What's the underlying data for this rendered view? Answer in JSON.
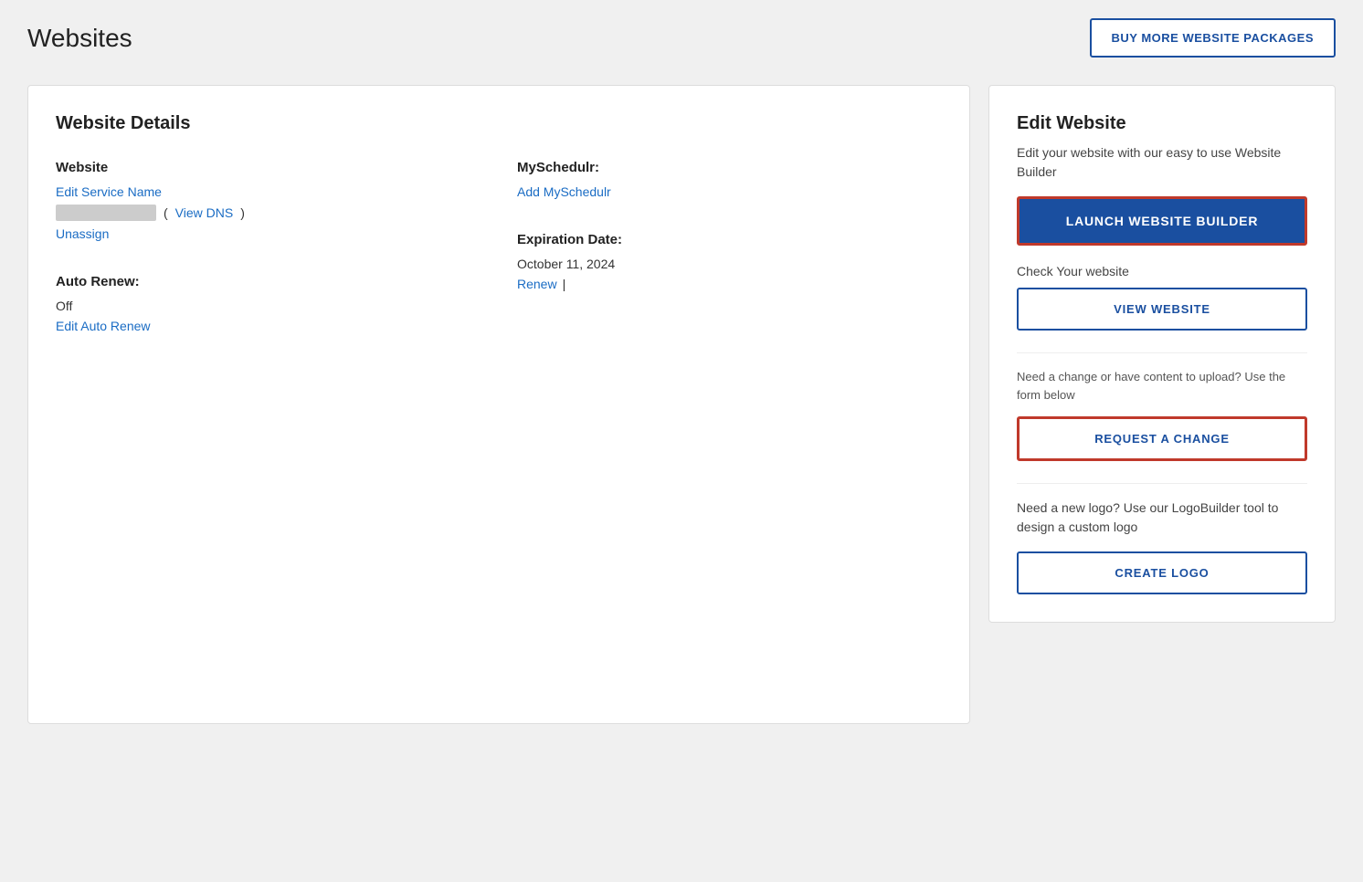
{
  "header": {
    "title": "Websites",
    "buy_more_label": "BUY MORE WEBSITE PACKAGES"
  },
  "left_panel": {
    "section_title": "Website Details",
    "website_label": "Website",
    "edit_service_name_link": "Edit Service Name",
    "view_dns_link": "View DNS",
    "unassign_link": "Unassign",
    "myschedulr_label": "MySchedulr:",
    "add_myschedulr_link": "Add MySchedulr",
    "auto_renew_label": "Auto Renew:",
    "auto_renew_value": "Off",
    "edit_auto_renew_link": "Edit Auto Renew",
    "expiration_date_label": "Expiration Date:",
    "expiration_date_value": "October 11, 2024",
    "renew_link": "Renew",
    "pipe_separator": "|"
  },
  "right_panel": {
    "section_title": "Edit Website",
    "description": "Edit your website with our easy to use Website Builder",
    "launch_btn_label": "LAUNCH WEBSITE BUILDER",
    "check_website_label": "Check Your website",
    "view_website_btn_label": "VIEW WEBSITE",
    "request_description": "Need a change or have content to upload? Use the form below",
    "request_change_btn_label": "REQUEST A CHANGE",
    "logo_description": "Need a new logo? Use our LogoBuilder tool to design a custom logo",
    "create_logo_btn_label": "CREATE LOGO"
  }
}
